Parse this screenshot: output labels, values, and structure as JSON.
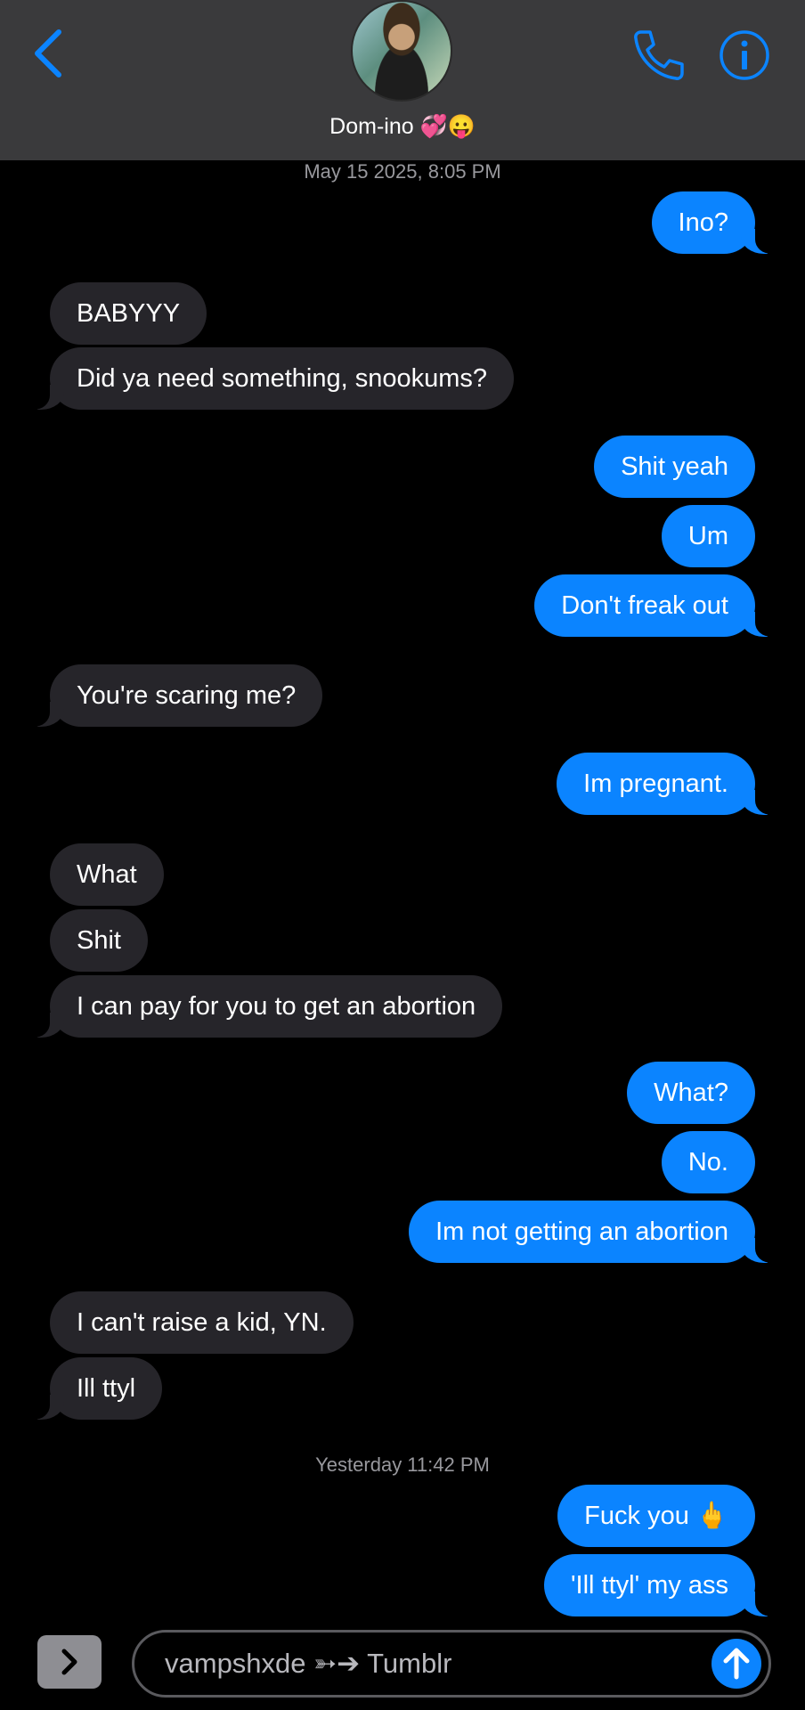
{
  "colors": {
    "accent": "#0b84ff",
    "incoming": "#26252a",
    "header": "#3a3a3c"
  },
  "header": {
    "contact_name": "Dom-ino 💞😛",
    "icons": [
      "back-chevron-icon",
      "avatar",
      "phone-icon",
      "info-icon"
    ]
  },
  "timestamps": {
    "first": "May 15 2025, 8:05 PM",
    "second": "Yesterday 11:42 PM"
  },
  "messages": [
    {
      "from": "me",
      "text": "Ino?"
    },
    {
      "from": "them",
      "text": "BABYYY"
    },
    {
      "from": "them",
      "text": "Did ya need something, snookums?"
    },
    {
      "from": "me",
      "text": "Shit yeah"
    },
    {
      "from": "me",
      "text": "Um"
    },
    {
      "from": "me",
      "text": "Don't freak out"
    },
    {
      "from": "them",
      "text": "You're scaring me?"
    },
    {
      "from": "me",
      "text": "Im pregnant."
    },
    {
      "from": "them",
      "text": "What"
    },
    {
      "from": "them",
      "text": "Shit"
    },
    {
      "from": "them",
      "text": "I can pay for you to get an abortion"
    },
    {
      "from": "me",
      "text": "What?"
    },
    {
      "from": "me",
      "text": "No."
    },
    {
      "from": "me",
      "text": "Im not getting an abortion"
    },
    {
      "from": "them",
      "text": "I can't raise a kid, YN."
    },
    {
      "from": "them",
      "text": "Ill ttyl"
    },
    {
      "from": "me",
      "text": "Fuck you 🖕"
    },
    {
      "from": "me",
      "text": "'Ill ttyl' my ass"
    }
  ],
  "compose": {
    "text": "vampshxde ➳➔ Tumblr"
  }
}
